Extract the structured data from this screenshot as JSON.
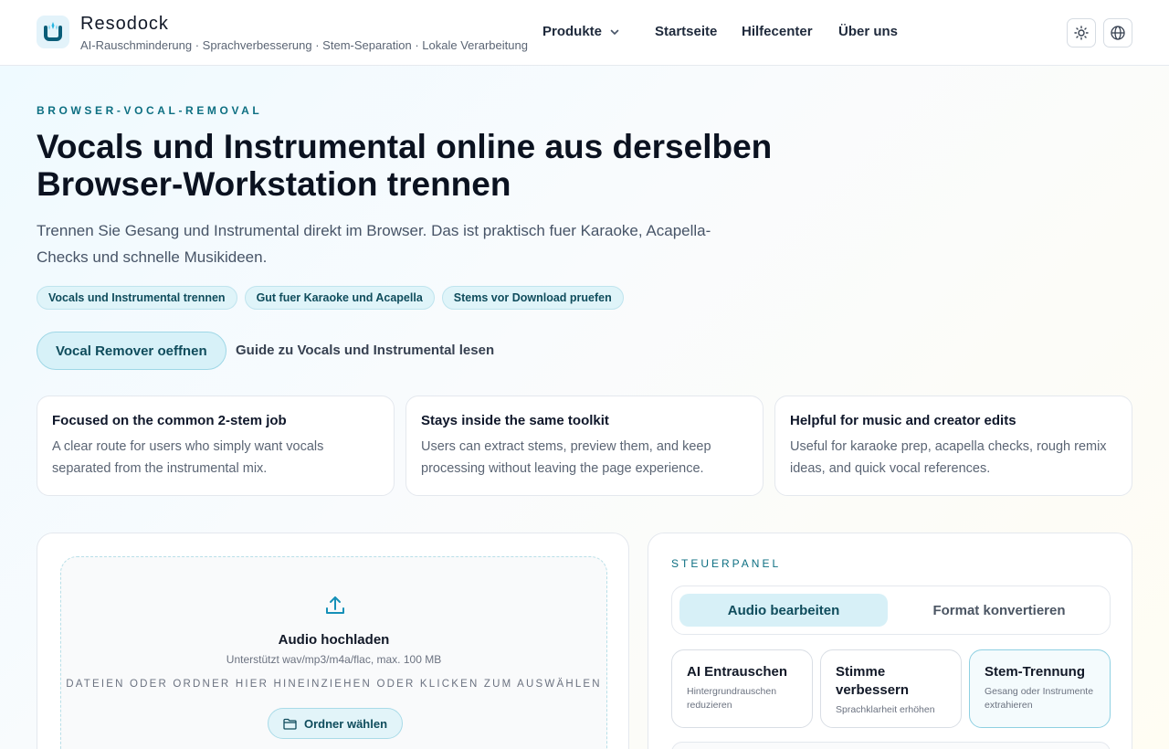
{
  "header": {
    "brand_name": "Resodock",
    "brand_tagline": "AI-Rauschminderung · Sprachverbesserung · Stem-Separation · Lokale Verarbeitung",
    "nav": {
      "produkte": "Produkte",
      "startseite": "Startseite",
      "hilfecenter": "Hilfecenter",
      "ueber_uns": "Über uns"
    },
    "icons": {
      "theme": "sun-icon",
      "language": "globe-icon",
      "dropdown": "chevron-down-icon"
    }
  },
  "hero": {
    "eyebrow": "BROWSER-VOCAL-REMOVAL",
    "title": "Vocals und Instrumental online aus derselben Browser-Workstation trennen",
    "subtitle": "Trennen Sie Gesang und Instrumental direkt im Browser. Das ist praktisch fuer Karaoke, Acapella-Checks und schnelle Musikideen.",
    "chips": [
      "Vocals und Instrumental trennen",
      "Gut fuer Karaoke und Acapella",
      "Stems vor Download pruefen"
    ],
    "cta_primary": "Vocal Remover oeffnen",
    "cta_secondary": "Guide zu Vocals und Instrumental lesen"
  },
  "features": [
    {
      "title": "Focused on the common 2-stem job",
      "text": "A clear route for users who simply want vocals separated from the instrumental mix."
    },
    {
      "title": "Stays inside the same toolkit",
      "text": "Users can extract stems, preview them, and keep processing without leaving the page experience."
    },
    {
      "title": "Helpful for music and creator edits",
      "text": "Useful for karaoke prep, acapella checks, rough remix ideas, and quick vocal references."
    }
  ],
  "upload": {
    "icon": "upload-icon",
    "title": "Audio hochladen",
    "hint": "Unterstützt wav/mp3/m4a/flac, max. 100 MB",
    "drag_text": "DATEIEN ODER ORDNER HIER HINEINZIEHEN ODER KLICKEN ZUM AUSWÄHLEN",
    "folder_button": "Ordner wählen",
    "folder_icon": "folder-icon"
  },
  "control_panel": {
    "title": "STEUERPANEL",
    "tabs": [
      "Audio bearbeiten",
      "Format konvertieren"
    ],
    "active_tab": "Audio bearbeiten",
    "modes": [
      {
        "title": "AI Entrauschen",
        "desc": "Hintergrundrauschen reduzieren"
      },
      {
        "title": "Stimme verbessern",
        "desc": "Sprachklarheit erhöhen"
      },
      {
        "title": "Stem-Trennung",
        "desc": "Gesang oder Instrumente extrahieren"
      }
    ],
    "selected_mode": "Stem-Trennung"
  },
  "colors": {
    "accent": "#0d6f82",
    "accent_light": "#d7f0f7",
    "border": "#e4e8ee"
  }
}
